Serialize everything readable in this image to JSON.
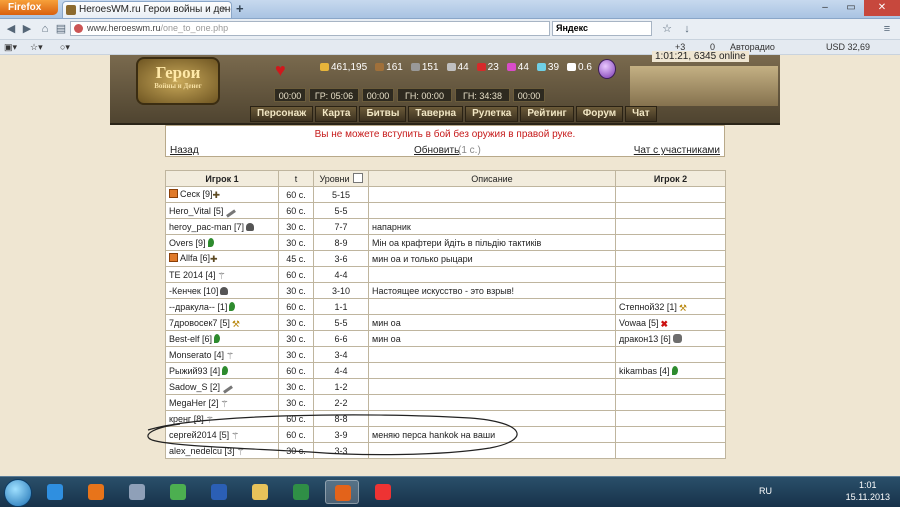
{
  "browser": {
    "menu_button": "Firefox",
    "tab_title": "HeroesWM.ru Герои войны и денег. Он...",
    "tab_close": "×",
    "new_tab": "+",
    "url_host": "www.heroeswm.ru",
    "url_path": "/one_to_one.php",
    "search_engine": "Яндекс",
    "bookmarks": [
      {
        "label": "+3"
      },
      {
        "label": "0"
      },
      {
        "label": "Авторадио"
      },
      {
        "label": "USD 32,69"
      }
    ]
  },
  "game": {
    "logo_main": "Герои",
    "logo_sub": "Войны и Денег",
    "server_time": "1:01:21, 6345 online",
    "resources": [
      {
        "value": "461,195",
        "color": "#e7b53a",
        "icon": "gold-icon"
      },
      {
        "value": "161",
        "color": "#a0703a",
        "icon": "wood-icon"
      },
      {
        "value": "151",
        "color": "#999999",
        "icon": "ore-icon"
      },
      {
        "value": "44",
        "color": "#c0c0c0",
        "icon": "mercury-icon"
      },
      {
        "value": "23",
        "color": "#d62a2a",
        "icon": "sulfur-icon"
      },
      {
        "value": "44",
        "color": "#d94cc9",
        "icon": "crystal-icon"
      },
      {
        "value": "39",
        "color": "#6fd0e6",
        "icon": "gem-icon"
      },
      {
        "value": "0.6",
        "color": "#ffffff",
        "icon": "diamond-icon"
      }
    ],
    "timers": [
      {
        "label": "00:00"
      },
      {
        "label": "ГР: 05:06"
      },
      {
        "label": "00:00"
      },
      {
        "label": "ГН: 00:00"
      },
      {
        "label": "ГН: 34:38"
      },
      {
        "label": "00:00"
      }
    ],
    "menu": [
      "Персонаж",
      "Карта",
      "Битвы",
      "Таверна",
      "Рулетка",
      "Рейтинг",
      "Форум",
      "Чат"
    ]
  },
  "notice": {
    "warning": "Вы не можете вступить в бой без оружия в правой руке.",
    "back": "Назад",
    "refresh": "Обновить",
    "refresh_note": "(1 с.)",
    "chat": "Чат с участниками"
  },
  "table": {
    "headers": {
      "player1": "Игрок 1",
      "t": "t",
      "levels": "Уровни",
      "desc": "Описание",
      "player2": "Игрок 2"
    },
    "rows": [
      {
        "p1": "Сеск [9]",
        "p1_icons": [
          "clan",
          "cross"
        ],
        "t": "60 с.",
        "lvl": "5-15",
        "desc": "",
        "p2": "",
        "p2_icons": []
      },
      {
        "p1": "Hero_Vital [5]",
        "p1_icons": [
          "sword"
        ],
        "t": "60 с.",
        "lvl": "5-5",
        "desc": "",
        "p2": "",
        "p2_icons": []
      },
      {
        "p1": "heroy_pac-man [7]",
        "p1_icons": [
          "helmet"
        ],
        "t": "30 с.",
        "lvl": "7-7",
        "desc": "напарник",
        "p2": "",
        "p2_icons": []
      },
      {
        "p1": "Overs [9]",
        "p1_icons": [
          "leaf"
        ],
        "t": "30 с.",
        "lvl": "8-9",
        "desc": "Мін оа крафтери йдіть в пільдію тактиків",
        "p2": "",
        "p2_icons": []
      },
      {
        "p1": "Allfa [6]",
        "p1_icons": [
          "clan",
          "cross"
        ],
        "t": "45 с.",
        "lvl": "3-6",
        "desc": "мин оа и только рыцари",
        "p2": "",
        "p2_icons": []
      },
      {
        "p1": "TE 2014 [4]",
        "p1_icons": [
          "wing"
        ],
        "t": "60 с.",
        "lvl": "4-4",
        "desc": "",
        "p2": "",
        "p2_icons": []
      },
      {
        "p1": "-Кенчек [10]",
        "p1_icons": [
          "helmet"
        ],
        "t": "30 с.",
        "lvl": "3-10",
        "desc": "Настоящее искусство - это взрыв!",
        "p2": "",
        "p2_icons": []
      },
      {
        "p1": "--дракула-- [1]",
        "p1_icons": [
          "leaf"
        ],
        "t": "60 с.",
        "lvl": "1-1",
        "desc": "",
        "p2": "Степной32 [1]",
        "p2_icons": [
          "hammer"
        ]
      },
      {
        "p1": "7дровосек7 [5]",
        "p1_icons": [
          "hammer"
        ],
        "t": "30 с.",
        "lvl": "5-5",
        "desc": "мин оа",
        "p2": "Vowaa [5]",
        "p2_icons": [
          "x"
        ]
      },
      {
        "p1": "Best-elf [6]",
        "p1_icons": [
          "leaf"
        ],
        "t": "30 с.",
        "lvl": "6-6",
        "desc": "мин оа",
        "p2": "дракон13 [6]",
        "p2_icons": [
          "mask"
        ]
      },
      {
        "p1": "Monserato [4]",
        "p1_icons": [
          "wing"
        ],
        "t": "30 с.",
        "lvl": "3-4",
        "desc": "",
        "p2": "",
        "p2_icons": []
      },
      {
        "p1": "Рыжий93 [4]",
        "p1_icons": [
          "leaf"
        ],
        "t": "60 с.",
        "lvl": "4-4",
        "desc": "",
        "p2": "kikambas [4]",
        "p2_icons": [
          "leaf"
        ]
      },
      {
        "p1": "Sadow_S [2]",
        "p1_icons": [
          "sword"
        ],
        "t": "30 с.",
        "lvl": "1-2",
        "desc": "",
        "p2": "",
        "p2_icons": []
      },
      {
        "p1": "MegaHer [2]",
        "p1_icons": [
          "wing"
        ],
        "t": "30 с.",
        "lvl": "2-2",
        "desc": "",
        "p2": "",
        "p2_icons": []
      },
      {
        "p1": "кренг [8]",
        "p1_icons": [
          "wing"
        ],
        "t": "60 с.",
        "lvl": "8-8",
        "desc": "",
        "p2": "",
        "p2_icons": []
      },
      {
        "p1": "сергей2014 [5]",
        "p1_icons": [
          "wing"
        ],
        "t": "60 с.",
        "lvl": "3-9",
        "desc": "меняю перса hankok на ваши",
        "p2": "",
        "p2_icons": []
      },
      {
        "p1": "alex_nedelcu [3]",
        "p1_icons": [
          "wing"
        ],
        "t": "30 с.",
        "lvl": "3-3",
        "desc": "",
        "p2": "",
        "p2_icons": []
      }
    ]
  },
  "taskbar": {
    "language": "RU",
    "time": "1:01",
    "date": "15.11.2013",
    "apps": [
      {
        "name": "internet-explorer",
        "color": "#2f8fe0"
      },
      {
        "name": "media-player",
        "color": "#e8741a"
      },
      {
        "name": "game-app",
        "color": "#8fa0b8"
      },
      {
        "name": "chrome",
        "color": "#4caf50"
      },
      {
        "name": "word",
        "color": "#2b5fb5"
      },
      {
        "name": "explorer",
        "color": "#e7c25a"
      },
      {
        "name": "excel",
        "color": "#2f8f46"
      },
      {
        "name": "firefox",
        "color": "#e3631a"
      },
      {
        "name": "yandex-browser",
        "color": "#e33"
      }
    ]
  }
}
